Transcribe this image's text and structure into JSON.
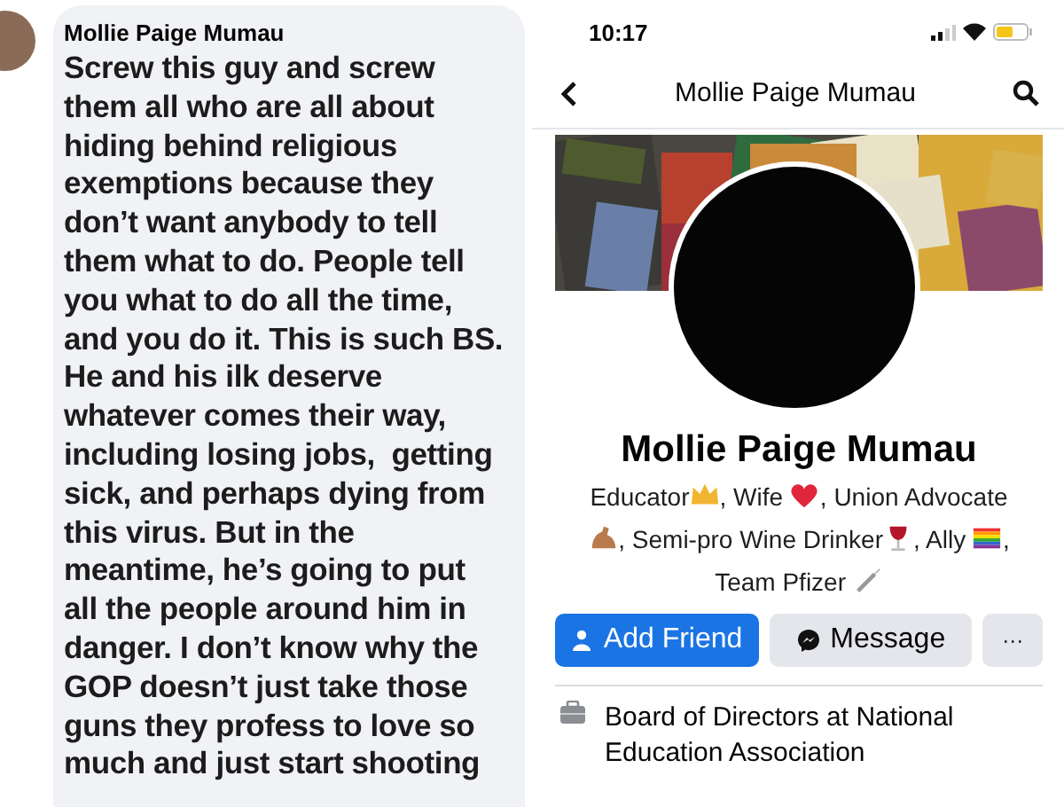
{
  "comment_panel": {
    "author": "Mollie Paige Mumau",
    "text": "Screw this guy and screw\nthem all who are all about\nhiding behind religious\nexemptions because they\ndon’t want anybody to tell\nthem what to do. People tell\nyou what to do all the time,\nand you do it. This is such BS.\nHe and his ilk deserve\nwhatever comes their way,\nincluding losing jobs,  getting\nsick, and perhaps dying from\nthis virus. But in the\nmeantime, he’s going to put\nall the people around him in\ndanger. I don’t know why the\nGOP doesn’t just take those\nguns they profess to love so\nmuch and just start shooting"
  },
  "profile_panel": {
    "status_bar": {
      "time": "10:17"
    },
    "nav": {
      "title": "Mollie Paige Mumau"
    },
    "cover": {
      "kind": "picture"
    },
    "name": "Mollie Paige Mumau",
    "bio": [
      [
        {
          "kind": "text",
          "text": "Educator"
        },
        {
          "kind": "crown"
        },
        {
          "kind": "text",
          "text": ", Wife "
        },
        {
          "kind": "heart"
        },
        {
          "kind": "text",
          "text": ", Union Advocate"
        }
      ],
      [
        {
          "kind": "arm"
        },
        {
          "kind": "text",
          "text": ", Semi-pro Wine Drinker"
        },
        {
          "kind": "wine"
        },
        {
          "kind": "text",
          "text": ", Ally "
        },
        {
          "kind": "flag"
        },
        {
          "kind": "text",
          "text": ","
        }
      ],
      [
        {
          "kind": "text",
          "text": "Team Pfizer "
        },
        {
          "kind": "syringe"
        }
      ]
    ],
    "buttons": [
      {
        "kind": "primary",
        "label": "Add Friend"
      },
      {
        "kind": "message",
        "label": "Message"
      },
      {
        "kind": "more",
        "label": "···"
      }
    ],
    "details": [
      {
        "kind": "work",
        "text": "Board of Directors at National\nEducation Association"
      }
    ]
  }
}
